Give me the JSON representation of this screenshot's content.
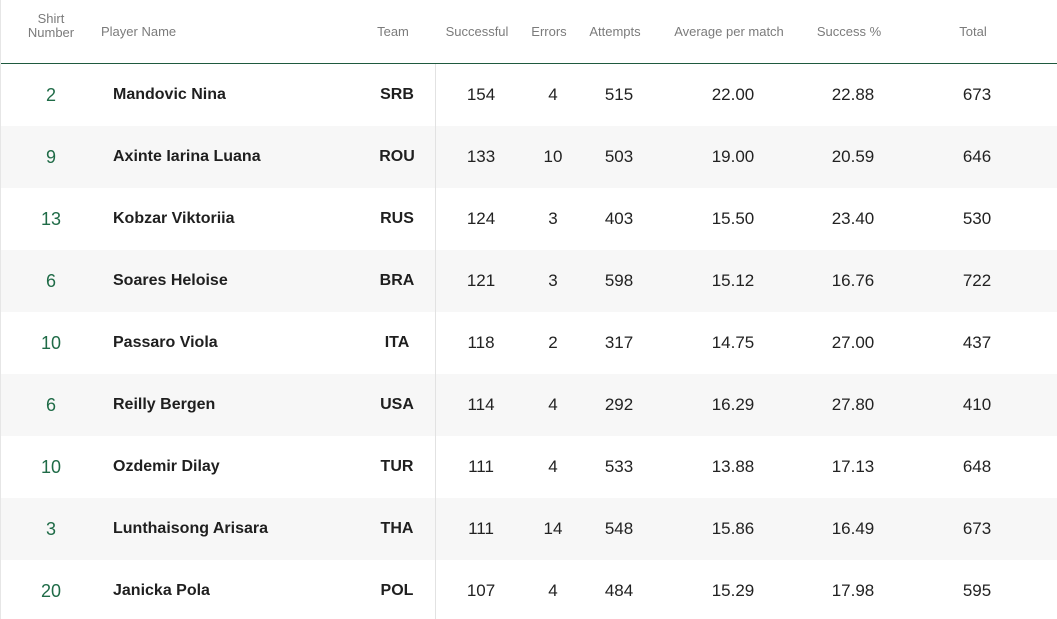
{
  "headers": {
    "shirt_line1": "Shirt",
    "shirt_line2": "Number",
    "player_name": "Player Name",
    "team": "Team",
    "successful": "Successful",
    "errors": "Errors",
    "attempts": "Attempts",
    "average_per_match": "Average per match",
    "success_pct": "Success %",
    "total": "Total"
  },
  "colors": {
    "accent": "#1f6b47",
    "header_rule": "#1f5a3f",
    "row_alt": "#f7f7f7"
  },
  "rows": [
    {
      "shirt": "2",
      "name": "Mandovic Nina",
      "team": "SRB",
      "successful": "154",
      "errors": "4",
      "attempts": "515",
      "average": "22.00",
      "pct": "22.88",
      "total": "673"
    },
    {
      "shirt": "9",
      "name": "Axinte Iarina Luana",
      "team": "ROU",
      "successful": "133",
      "errors": "10",
      "attempts": "503",
      "average": "19.00",
      "pct": "20.59",
      "total": "646"
    },
    {
      "shirt": "13",
      "name": "Kobzar Viktoriia",
      "team": "RUS",
      "successful": "124",
      "errors": "3",
      "attempts": "403",
      "average": "15.50",
      "pct": "23.40",
      "total": "530"
    },
    {
      "shirt": "6",
      "name": "Soares Heloise",
      "team": "BRA",
      "successful": "121",
      "errors": "3",
      "attempts": "598",
      "average": "15.12",
      "pct": "16.76",
      "total": "722"
    },
    {
      "shirt": "10",
      "name": "Passaro Viola",
      "team": "ITA",
      "successful": "118",
      "errors": "2",
      "attempts": "317",
      "average": "14.75",
      "pct": "27.00",
      "total": "437"
    },
    {
      "shirt": "6",
      "name": "Reilly Bergen",
      "team": "USA",
      "successful": "114",
      "errors": "4",
      "attempts": "292",
      "average": "16.29",
      "pct": "27.80",
      "total": "410"
    },
    {
      "shirt": "10",
      "name": "Ozdemir Dilay",
      "team": "TUR",
      "successful": "111",
      "errors": "4",
      "attempts": "533",
      "average": "13.88",
      "pct": "17.13",
      "total": "648"
    },
    {
      "shirt": "3",
      "name": "Lunthaisong Arisara",
      "team": "THA",
      "successful": "111",
      "errors": "14",
      "attempts": "548",
      "average": "15.86",
      "pct": "16.49",
      "total": "673"
    },
    {
      "shirt": "20",
      "name": "Janicka Pola",
      "team": "POL",
      "successful": "107",
      "errors": "4",
      "attempts": "484",
      "average": "15.29",
      "pct": "17.98",
      "total": "595"
    }
  ]
}
